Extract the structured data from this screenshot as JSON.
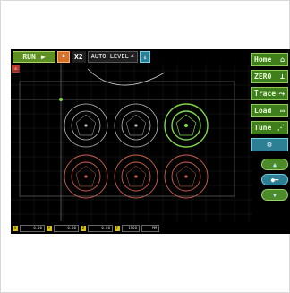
{
  "toolbar": {
    "run_label": "RUN",
    "run_icon": "play-icon",
    "pause_icon": "pause-icon",
    "multiplier": "X2",
    "autolevel_label": "AUTO LEVEL",
    "probe_icon": "probe-icon"
  },
  "sidebar": {
    "items": [
      {
        "label": "Home",
        "icon": "home-icon"
      },
      {
        "label": "ZERO",
        "icon": "zero-icon"
      },
      {
        "label": "Trace",
        "icon": "trace-icon"
      },
      {
        "label": "Load",
        "icon": "folder-icon"
      },
      {
        "label": "Tune",
        "icon": "tune-icon"
      }
    ],
    "settings_icon": "gear-icon"
  },
  "jog": {
    "up_icon": "triangle-up-icon",
    "mid_icon": "slider-icon",
    "down_icon": "triangle-down-icon"
  },
  "status": {
    "axes": [
      {
        "label": "X",
        "value": "0.00"
      },
      {
        "label": "Y",
        "value": "0.00"
      },
      {
        "label": "Z",
        "value": "0.00"
      },
      {
        "label": "F",
        "value": "1500"
      },
      {
        "label": "",
        "value": "MM"
      }
    ]
  },
  "colors": {
    "selected": "#7ed84a",
    "white_part": "#bdbdbd",
    "red_part": "#d0614b",
    "grid": "#2a2a2a"
  }
}
